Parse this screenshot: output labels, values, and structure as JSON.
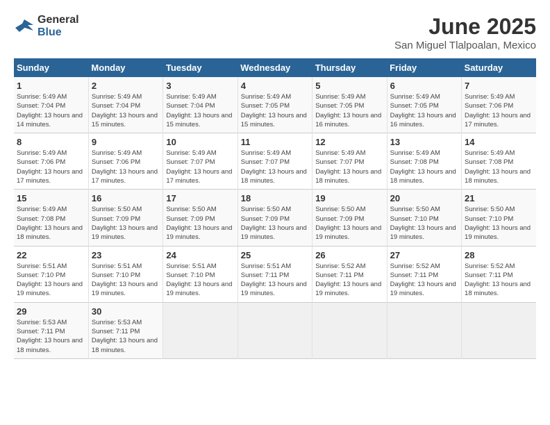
{
  "header": {
    "logo": {
      "general": "General",
      "blue": "Blue"
    },
    "title": "June 2025",
    "subtitle": "San Miguel Tlalpoalan, Mexico"
  },
  "days_of_week": [
    "Sunday",
    "Monday",
    "Tuesday",
    "Wednesday",
    "Thursday",
    "Friday",
    "Saturday"
  ],
  "weeks": [
    [
      {
        "num": "1",
        "sunrise": "5:49 AM",
        "sunset": "7:04 PM",
        "daylight": "13 hours and 14 minutes."
      },
      {
        "num": "2",
        "sunrise": "5:49 AM",
        "sunset": "7:04 PM",
        "daylight": "13 hours and 15 minutes."
      },
      {
        "num": "3",
        "sunrise": "5:49 AM",
        "sunset": "7:04 PM",
        "daylight": "13 hours and 15 minutes."
      },
      {
        "num": "4",
        "sunrise": "5:49 AM",
        "sunset": "7:05 PM",
        "daylight": "13 hours and 15 minutes."
      },
      {
        "num": "5",
        "sunrise": "5:49 AM",
        "sunset": "7:05 PM",
        "daylight": "13 hours and 16 minutes."
      },
      {
        "num": "6",
        "sunrise": "5:49 AM",
        "sunset": "7:05 PM",
        "daylight": "13 hours and 16 minutes."
      },
      {
        "num": "7",
        "sunrise": "5:49 AM",
        "sunset": "7:06 PM",
        "daylight": "13 hours and 17 minutes."
      }
    ],
    [
      {
        "num": "8",
        "sunrise": "5:49 AM",
        "sunset": "7:06 PM",
        "daylight": "13 hours and 17 minutes."
      },
      {
        "num": "9",
        "sunrise": "5:49 AM",
        "sunset": "7:06 PM",
        "daylight": "13 hours and 17 minutes."
      },
      {
        "num": "10",
        "sunrise": "5:49 AM",
        "sunset": "7:07 PM",
        "daylight": "13 hours and 17 minutes."
      },
      {
        "num": "11",
        "sunrise": "5:49 AM",
        "sunset": "7:07 PM",
        "daylight": "13 hours and 18 minutes."
      },
      {
        "num": "12",
        "sunrise": "5:49 AM",
        "sunset": "7:07 PM",
        "daylight": "13 hours and 18 minutes."
      },
      {
        "num": "13",
        "sunrise": "5:49 AM",
        "sunset": "7:08 PM",
        "daylight": "13 hours and 18 minutes."
      },
      {
        "num": "14",
        "sunrise": "5:49 AM",
        "sunset": "7:08 PM",
        "daylight": "13 hours and 18 minutes."
      }
    ],
    [
      {
        "num": "15",
        "sunrise": "5:49 AM",
        "sunset": "7:08 PM",
        "daylight": "13 hours and 18 minutes."
      },
      {
        "num": "16",
        "sunrise": "5:50 AM",
        "sunset": "7:09 PM",
        "daylight": "13 hours and 19 minutes."
      },
      {
        "num": "17",
        "sunrise": "5:50 AM",
        "sunset": "7:09 PM",
        "daylight": "13 hours and 19 minutes."
      },
      {
        "num": "18",
        "sunrise": "5:50 AM",
        "sunset": "7:09 PM",
        "daylight": "13 hours and 19 minutes."
      },
      {
        "num": "19",
        "sunrise": "5:50 AM",
        "sunset": "7:09 PM",
        "daylight": "13 hours and 19 minutes."
      },
      {
        "num": "20",
        "sunrise": "5:50 AM",
        "sunset": "7:10 PM",
        "daylight": "13 hours and 19 minutes."
      },
      {
        "num": "21",
        "sunrise": "5:50 AM",
        "sunset": "7:10 PM",
        "daylight": "13 hours and 19 minutes."
      }
    ],
    [
      {
        "num": "22",
        "sunrise": "5:51 AM",
        "sunset": "7:10 PM",
        "daylight": "13 hours and 19 minutes."
      },
      {
        "num": "23",
        "sunrise": "5:51 AM",
        "sunset": "7:10 PM",
        "daylight": "13 hours and 19 minutes."
      },
      {
        "num": "24",
        "sunrise": "5:51 AM",
        "sunset": "7:10 PM",
        "daylight": "13 hours and 19 minutes."
      },
      {
        "num": "25",
        "sunrise": "5:51 AM",
        "sunset": "7:11 PM",
        "daylight": "13 hours and 19 minutes."
      },
      {
        "num": "26",
        "sunrise": "5:52 AM",
        "sunset": "7:11 PM",
        "daylight": "13 hours and 19 minutes."
      },
      {
        "num": "27",
        "sunrise": "5:52 AM",
        "sunset": "7:11 PM",
        "daylight": "13 hours and 19 minutes."
      },
      {
        "num": "28",
        "sunrise": "5:52 AM",
        "sunset": "7:11 PM",
        "daylight": "13 hours and 18 minutes."
      }
    ],
    [
      {
        "num": "29",
        "sunrise": "5:53 AM",
        "sunset": "7:11 PM",
        "daylight": "13 hours and 18 minutes."
      },
      {
        "num": "30",
        "sunrise": "5:53 AM",
        "sunset": "7:11 PM",
        "daylight": "13 hours and 18 minutes."
      },
      null,
      null,
      null,
      null,
      null
    ]
  ]
}
